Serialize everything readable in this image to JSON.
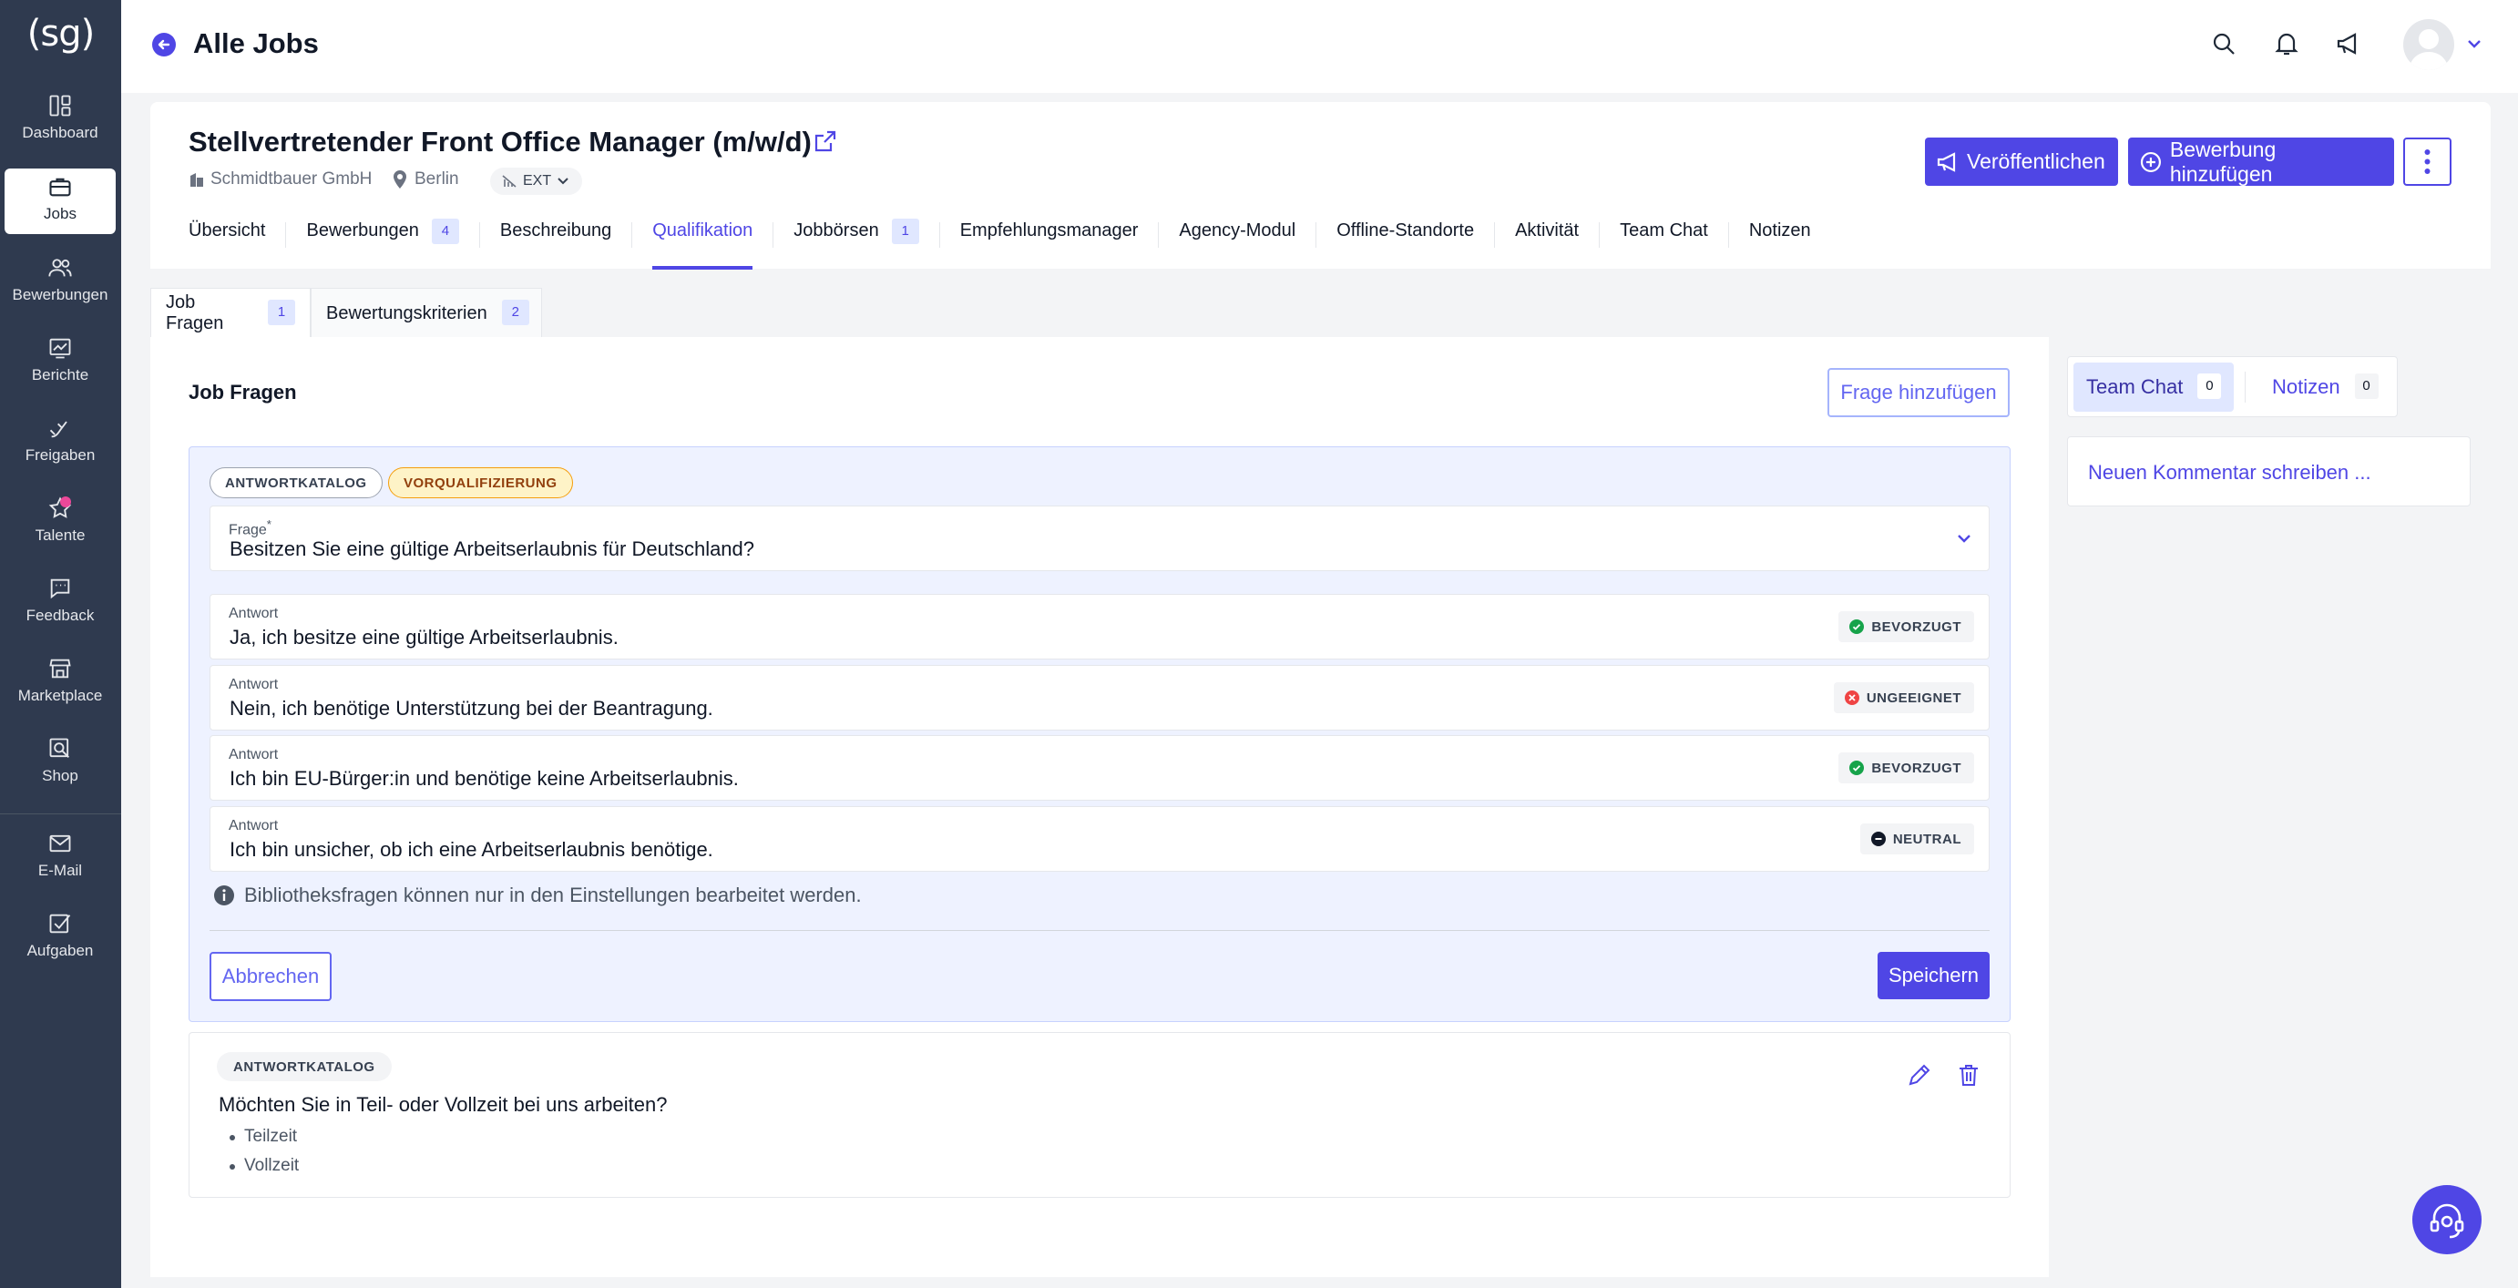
{
  "app": {
    "logo_text": "(sg)"
  },
  "sidebar": {
    "items": [
      {
        "label": "Dashboard",
        "icon": "dashboard-icon"
      },
      {
        "label": "Jobs",
        "icon": "briefcase-icon",
        "active": true
      },
      {
        "label": "Bewerbungen",
        "icon": "users-icon"
      },
      {
        "label": "Berichte",
        "icon": "report-icon"
      },
      {
        "label": "Freigaben",
        "icon": "approval-icon"
      },
      {
        "label": "Talente",
        "icon": "star-icon"
      },
      {
        "label": "Feedback",
        "icon": "feedback-icon"
      },
      {
        "label": "Marketplace",
        "icon": "store-icon"
      },
      {
        "label": "Shop",
        "icon": "shop-icon"
      },
      {
        "label": "E-Mail",
        "icon": "mail-icon"
      },
      {
        "label": "Aufgaben",
        "icon": "checkbox-icon"
      }
    ]
  },
  "header": {
    "title": "Alle Jobs"
  },
  "job": {
    "title": "Stellvertretender Front Office Manager (m/w/d)",
    "company": "Schmidtbauer GmbH",
    "location": "Berlin",
    "badge": "EXT",
    "publish_label": "Veröffentlichen",
    "add_application_label": "Bewerbung hinzufügen"
  },
  "tabs": [
    {
      "label": "Übersicht"
    },
    {
      "label": "Bewerbungen",
      "count": "4"
    },
    {
      "label": "Beschreibung"
    },
    {
      "label": "Qualifikation",
      "active": true
    },
    {
      "label": "Jobbörsen",
      "count": "1"
    },
    {
      "label": "Empfehlungsmanager"
    },
    {
      "label": "Agency-Modul"
    },
    {
      "label": "Offline-Standorte"
    },
    {
      "label": "Aktivität"
    },
    {
      "label": "Team Chat"
    },
    {
      "label": "Notizen"
    }
  ],
  "subtabs": [
    {
      "label": "Job Fragen",
      "count": "1"
    },
    {
      "label": "Bewertungskriterien",
      "count": "2"
    }
  ],
  "section": {
    "title": "Job Fragen",
    "add_label": "Frage hinzufügen"
  },
  "editor": {
    "chip_catalog": "ANTWORTKATALOG",
    "chip_prequal": "VORQUALIFIZIERUNG",
    "question_label": "Frage",
    "question_required": "*",
    "question_value": "Besitzen Sie eine gültige Arbeitserlaubnis für Deutschland?",
    "answer_label": "Antwort",
    "answers": [
      {
        "text": "Ja, ich besitze eine gültige Arbeitserlaubnis.",
        "status": "BEVORZUGT",
        "color": "#16a34a"
      },
      {
        "text": "Nein, ich benötige Unterstützung bei der Beantragung.",
        "status": "UNGEEIGNET",
        "color": "#ef4444"
      },
      {
        "text": "Ich bin EU-Bürger:in und benötige keine Arbeitserlaubnis.",
        "status": "BEVORZUGT",
        "color": "#16a34a"
      },
      {
        "text": "Ich bin unsicher, ob ich eine Arbeitserlaubnis benötige.",
        "status": "NEUTRAL",
        "color": "#111827"
      }
    ],
    "info": "Bibliotheksfragen können nur in den Einstellungen bearbeitet werden.",
    "cancel_label": "Abbrechen",
    "save_label": "Speichern"
  },
  "saved_question": {
    "chip": "ANTWORTKATALOG",
    "question": "Möchten Sie in Teil- oder Vollzeit bei uns arbeiten?",
    "answers": [
      "Teilzeit",
      "Vollzeit"
    ]
  },
  "right_panel": {
    "team_chat_label": "Team Chat",
    "team_chat_count": "0",
    "notes_label": "Notizen",
    "notes_count": "0",
    "comment_placeholder": "Neuen Kommentar schreiben ..."
  },
  "colors": {
    "accent": "#4f46e5",
    "sidebar": "#2f3a4f"
  }
}
